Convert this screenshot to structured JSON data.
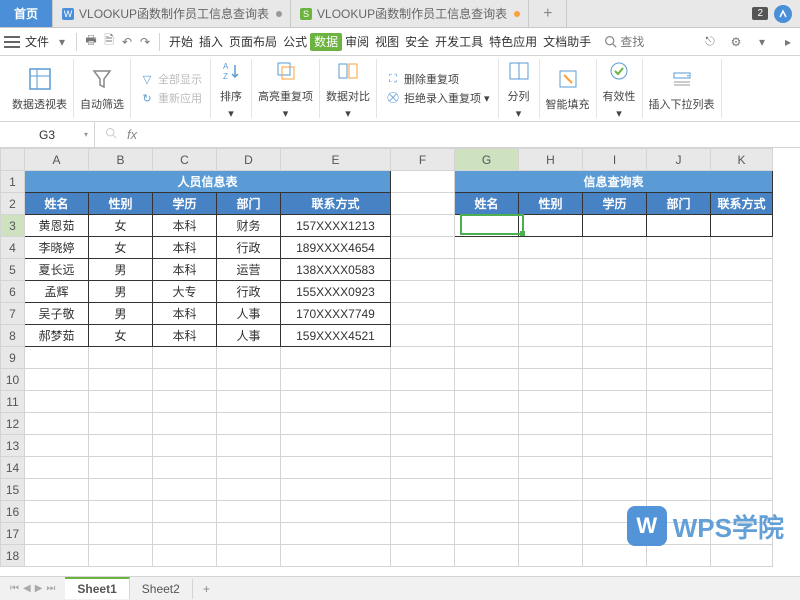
{
  "tabbar": {
    "home": "首页",
    "tab1": "VLOOKUP函数制作员工信息查询表",
    "tab2": "VLOOKUP函数制作员工信息查询表",
    "badge": "2"
  },
  "menubar": {
    "file": "文件",
    "items": [
      "开始",
      "插入",
      "页面布局",
      "公式",
      "数据",
      "审阅",
      "视图",
      "安全",
      "开发工具",
      "特色应用",
      "文档助手"
    ],
    "active_index": 4,
    "search": "查找"
  },
  "ribbon": {
    "pivot": "数据透视表",
    "autofilter": "自动筛选",
    "showall": "全部显示",
    "reapply": "重新应用",
    "sort": "排序",
    "highlight_dup": "高亮重复项",
    "data_compare": "数据对比",
    "del_dup": "删除重复项",
    "reject_dup": "拒绝录入重复项",
    "text_to_cols": "分列",
    "smart_fill": "智能填充",
    "validity": "有效性",
    "dropdown": "插入下拉列表"
  },
  "formula_bar": {
    "name_box": "G3"
  },
  "sheet": {
    "cols": [
      "A",
      "B",
      "C",
      "D",
      "E",
      "F",
      "G",
      "H",
      "I",
      "J",
      "K"
    ],
    "selected_col": "G",
    "selected_row": 3,
    "visible_rows": 18,
    "title1": "人员信息表",
    "title2": "信息查询表",
    "headers": [
      "姓名",
      "性别",
      "学历",
      "部门",
      "联系方式"
    ],
    "headers2": [
      "姓名",
      "性别",
      "学历",
      "部门",
      "联系方式"
    ],
    "rows": [
      {
        "name": "黄恩茹",
        "sex": "女",
        "edu": "本科",
        "dept": "财务",
        "phone": "157XXXX1213"
      },
      {
        "name": "李晓婷",
        "sex": "女",
        "edu": "本科",
        "dept": "行政",
        "phone": "189XXXX4654"
      },
      {
        "name": "夏长远",
        "sex": "男",
        "edu": "本科",
        "dept": "运营",
        "phone": "138XXXX0583"
      },
      {
        "name": "孟辉",
        "sex": "男",
        "edu": "大专",
        "dept": "行政",
        "phone": "155XXXX0923"
      },
      {
        "name": "吴子敬",
        "sex": "男",
        "edu": "本科",
        "dept": "人事",
        "phone": "170XXXX7749"
      },
      {
        "name": "郝梦茹",
        "sex": "女",
        "edu": "本科",
        "dept": "人事",
        "phone": "159XXXX4521"
      }
    ]
  },
  "sheet_tabs": {
    "tabs": [
      "Sheet1",
      "Sheet2"
    ],
    "active": 0
  },
  "watermark": "WPS学院"
}
